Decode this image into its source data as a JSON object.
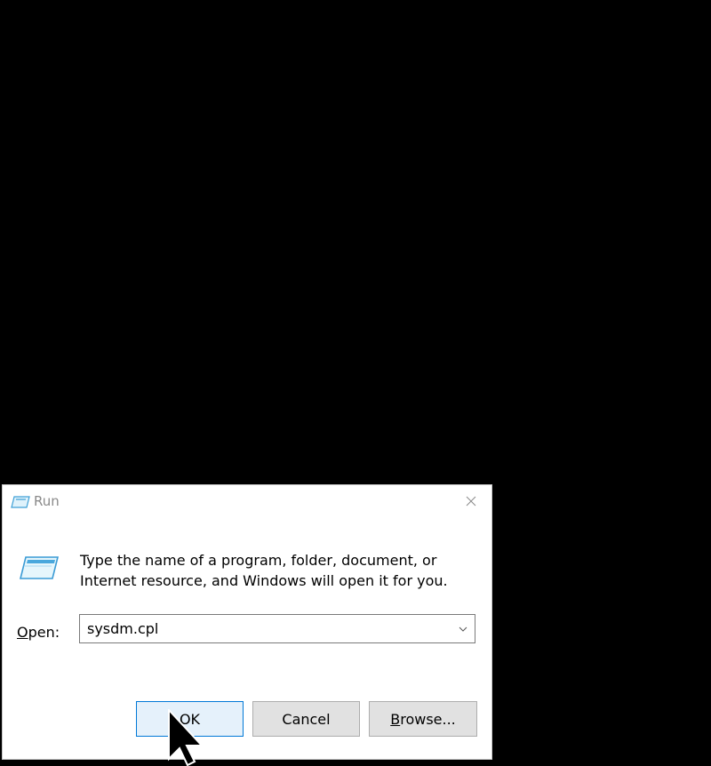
{
  "window": {
    "title": "Run",
    "title_icon": "run-icon",
    "close_icon": "close-icon"
  },
  "dialog": {
    "description_line1": "Type the name of a program, folder, document, or",
    "description_line2": "Internet resource, and Windows will open it for you.",
    "icon": "run-icon"
  },
  "open": {
    "label_accel": "O",
    "label_rest": "pen:",
    "value": "sysdm.cpl",
    "dropdown_icon": "chevron-down-icon"
  },
  "buttons": {
    "ok": "OK",
    "cancel": "Cancel",
    "browse_accel": "B",
    "browse_rest": "rowse..."
  },
  "colors": {
    "background": "#000000",
    "dialog_bg": "#ffffff",
    "ok_border": "#0078d7",
    "ok_bg": "#e5f1fb",
    "button_bg": "#e1e1e1"
  },
  "cursor": "arrow-cursor-icon"
}
